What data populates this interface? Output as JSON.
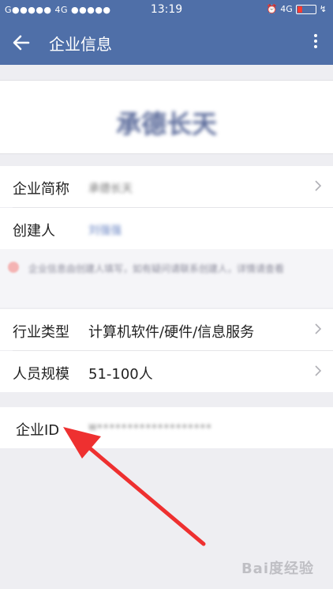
{
  "status_bar": {
    "carrier": "G●●●●● 4G ●●●●●",
    "time": "13:19",
    "network": "4G"
  },
  "app_bar": {
    "title": "企业信息",
    "back_icon": "arrow-left-icon",
    "more_icon": "more-vertical-icon"
  },
  "company": {
    "name": "承德长天"
  },
  "basic_rows": [
    {
      "label": "企业简称",
      "value": "承德长天"
    },
    {
      "label": "创建人",
      "value": "刘强强"
    }
  ],
  "note": {
    "text": "企业信息由创建人填写，如有疑问请联系创建人，详情请查看"
  },
  "detail_rows": [
    {
      "label": "行业类型",
      "value": "计算机软件/硬件/信息服务"
    },
    {
      "label": "人员规模",
      "value": "51-100人"
    }
  ],
  "id_row": {
    "label": "企业ID",
    "value": "w•••••••••••••••••••"
  },
  "watermark": "Bai度经验",
  "colors": {
    "header": "#4f6fa8",
    "annotation_arrow": "#ee3030"
  }
}
